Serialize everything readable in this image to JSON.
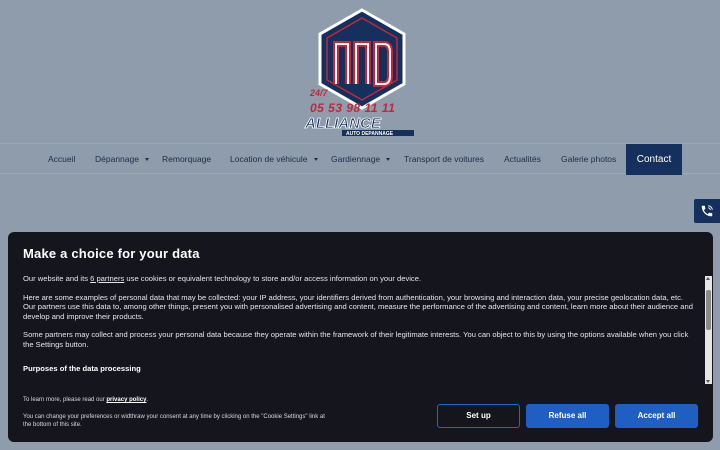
{
  "logo": {
    "monogram": "AAD",
    "badge": "24/7",
    "phone": "05 53 98 11 11",
    "brand": "ALLIANCE",
    "tagline": "AUTO DEPANNAGE"
  },
  "nav": {
    "items": [
      {
        "label": "Accueil",
        "dropdown": false
      },
      {
        "label": "Dépannage",
        "dropdown": true
      },
      {
        "label": "Remorquage",
        "dropdown": false
      },
      {
        "label": "Location de véhicule",
        "dropdown": true
      },
      {
        "label": "Gardiennage",
        "dropdown": true
      },
      {
        "label": "Transport de voitures",
        "dropdown": false
      },
      {
        "label": "Actualités",
        "dropdown": false
      },
      {
        "label": "Galerie photos",
        "dropdown": false
      }
    ],
    "contact_label": "Contact"
  },
  "floating": {
    "icon": "phone-icon"
  },
  "consent": {
    "title": "Make a choice for your data",
    "p1_before": "Our website and its ",
    "p1_link": "6 partners",
    "p1_after": " use cookies or equivalent technology to store and/or access information on your device.",
    "p2": "Here are some examples of personal data that may be collected: your IP address, your identifiers derived from authentication, your browsing and interaction data, your precise geolocation data, etc.",
    "p3": "Our partners use this data to, among other things, present you with personalised advertising and content, measure the performance of the advertising and content, learn more about their audience and develop and improve their products.",
    "p4": "Some partners may collect and process your personal data because they operate within the framework of their legitimate interests. You can object to this by using the options available when you click the Settings button.",
    "purposes_heading": "Purposes of the data processing",
    "learn_more_before": "To learn more, please read our ",
    "learn_more_link": "privacy policy",
    "learn_more_after": ".",
    "change_note": "You can change your preferences or widthraw your consent at any time by clicking on the \"Cookie Settings\" link at the bottom of this site.",
    "buttons": {
      "setup": "Set up",
      "refuse": "Refuse all",
      "accept": "Accept all"
    }
  },
  "colors": {
    "background": "#8e9cac",
    "navy": "#16305e",
    "modal": "#15161d",
    "button_blue": "#1f5fc4",
    "logo_red": "#c0283a"
  }
}
